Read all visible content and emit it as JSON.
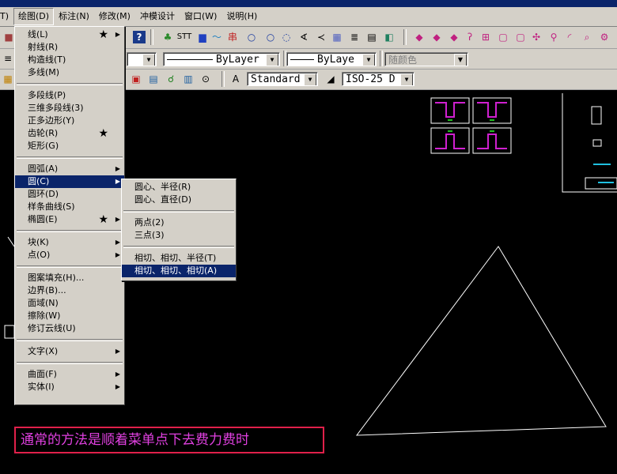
{
  "menubar": {
    "items": [
      "T)",
      "绘图(D)",
      "标注(N)",
      "修改(M)",
      "冲模设计",
      "窗口(W)",
      "说明(H)"
    ]
  },
  "toolbar": {
    "text_style": "Standard",
    "dim_style": "ISO-25 D",
    "linetype": "ByLayer",
    "lineweight": "ByLaye",
    "plot_style": "随颜色",
    "stt_label": "STT"
  },
  "draw_menu": {
    "items": [
      "线(L)",
      "射线(R)",
      "构造线(T)",
      "多线(M)",
      "多段线(P)",
      "三维多段线(3)",
      "正多边形(Y)",
      "齿轮(R)",
      "矩形(G)",
      "圆弧(A)",
      "圆(C)",
      "圆环(D)",
      "样条曲线(S)",
      "椭圆(E)",
      "块(K)",
      "点(O)",
      "图案填充(H)...",
      "边界(B)...",
      "面域(N)",
      "擦除(W)",
      "修订云线(U)",
      "文字(X)",
      "曲面(F)",
      "实体(I)"
    ]
  },
  "circle_submenu": {
    "items": [
      "圆心、半径(R)",
      "圆心、直径(D)",
      "两点(2)",
      "三点(3)",
      "相切、相切、半径(T)",
      "相切、相切、相切(A)"
    ]
  },
  "caption": "通常的方法是顺着菜单点下去费力费时",
  "colors": {
    "menu_bg": "#d4d0c8",
    "highlight": "#0a246a",
    "caption_border": "#e0204a",
    "caption_text": "#e040e0",
    "cad_part": "#d020d0"
  }
}
